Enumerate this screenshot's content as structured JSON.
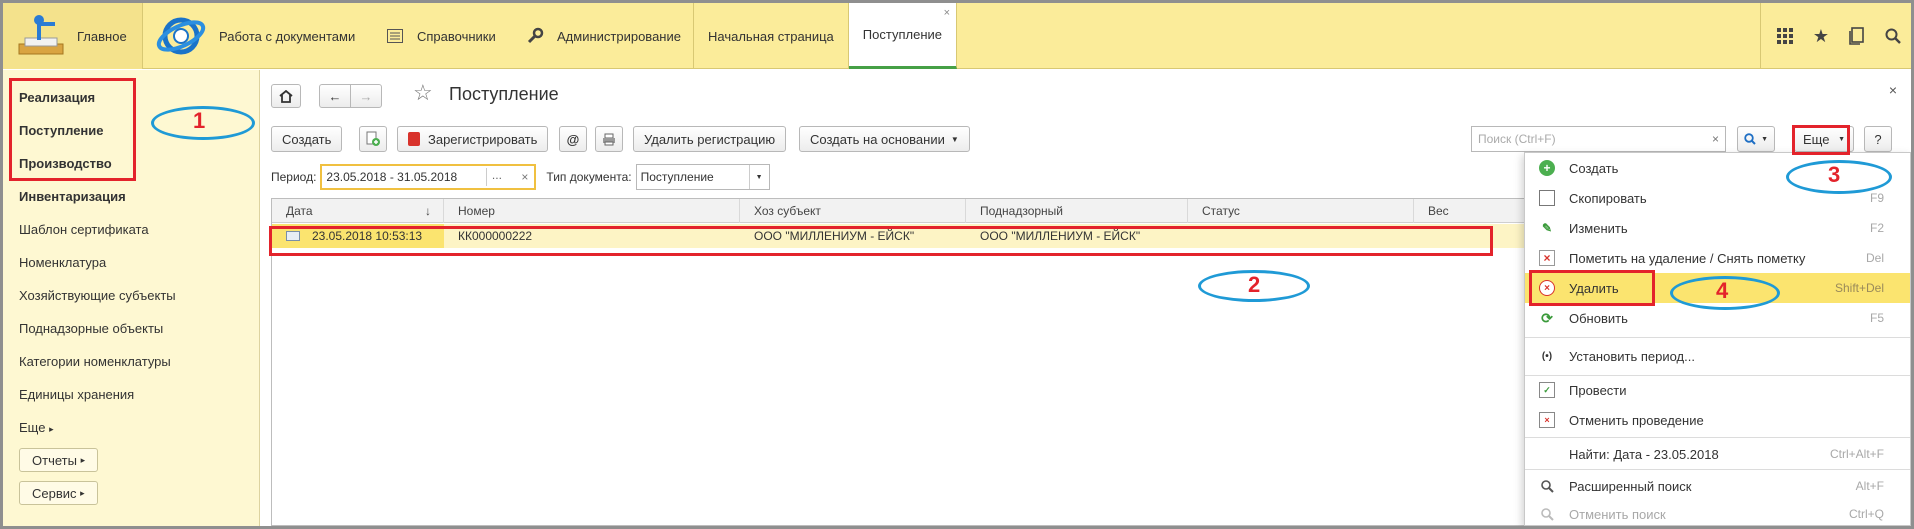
{
  "topbar": {
    "sections": {
      "main": "Главное",
      "docs": "Работа с документами",
      "references": "Справочники",
      "admin": "Администрирование"
    },
    "open_tabs": [
      "Начальная страница",
      "Поступление"
    ],
    "close_glyph": "×",
    "icons": [
      "apps-grid-icon",
      "star-icon",
      "history-icon",
      "search-icon"
    ]
  },
  "sidebar": {
    "items_bold": [
      "Реализация",
      "Поступление",
      "Производство",
      "Инвентаризация"
    ],
    "items": [
      "Шаблон сертификата",
      "Номенклатура",
      "Хозяйствующие субъекты",
      "Поднадзорные объекты",
      "Категории номенклатуры",
      "Единицы хранения"
    ],
    "more": "Еще",
    "buttons": [
      "Отчеты",
      "Сервис"
    ]
  },
  "main": {
    "title": "Поступление",
    "toolbar": {
      "create": "Создать",
      "register": "Зарегистрировать",
      "delete_registration": "Удалить регистрацию",
      "create_based_on": "Создать на основании",
      "more": "Еще",
      "help": "?",
      "search_placeholder": "Поиск (Ctrl+F)"
    },
    "filters": {
      "period_label": "Период:",
      "period_value": "23.05.2018 - 31.05.2018",
      "doc_type_label": "Тип документа:",
      "doc_type_value": "Поступление"
    },
    "table": {
      "columns": [
        "Дата",
        "Номер",
        "Хоз субъект",
        "Поднадзорный",
        "Статус",
        "Вес"
      ],
      "rows": [
        [
          "23.05.2018 10:53:13",
          "КК000000222",
          "ООО  \"МИЛЛЕНИУМ - ЕЙСК\"",
          "ООО  \"МИЛЛЕНИУМ - ЕЙСК\"",
          "",
          ""
        ]
      ]
    }
  },
  "menu": {
    "items": [
      {
        "label": "Создать",
        "key": "",
        "icon": "add-icon"
      },
      {
        "label": "Скопировать",
        "key": "F9",
        "icon": "copy-icon"
      },
      {
        "label": "Изменить",
        "key": "F2",
        "icon": "edit-icon"
      },
      {
        "label": "Пометить на удаление / Снять пометку",
        "key": "Del",
        "icon": "mark-delete-icon"
      },
      {
        "label": "Удалить",
        "key": "Shift+Del",
        "icon": "delete-icon"
      },
      {
        "label": "Обновить",
        "key": "F5",
        "icon": "refresh-icon"
      },
      {
        "label": "Установить период...",
        "key": "",
        "icon": "period-icon"
      },
      {
        "label": "Провести",
        "key": "",
        "icon": "post-icon"
      },
      {
        "label": "Отменить проведение",
        "key": "",
        "icon": "unpost-icon"
      },
      {
        "label": "Найти: Дата - 23.05.2018",
        "key": "Ctrl+Alt+F",
        "icon": ""
      },
      {
        "label": "Расширенный поиск",
        "key": "Alt+F",
        "icon": "advanced-search-icon"
      },
      {
        "label": "Отменить поиск",
        "key": "Ctrl+Q",
        "icon": "cancel-search-icon"
      }
    ],
    "highlighted": "Удалить"
  },
  "annotations": [
    "1",
    "2",
    "3",
    "4"
  ],
  "colors": {
    "topbar": "#fbec9a",
    "sidebar": "#fef8d2",
    "annotation_red": "#e3232b",
    "annotation_blue": "#1f9ad6",
    "row_selected": "#fdf4c5",
    "menu_highlight": "#fbe46f"
  }
}
